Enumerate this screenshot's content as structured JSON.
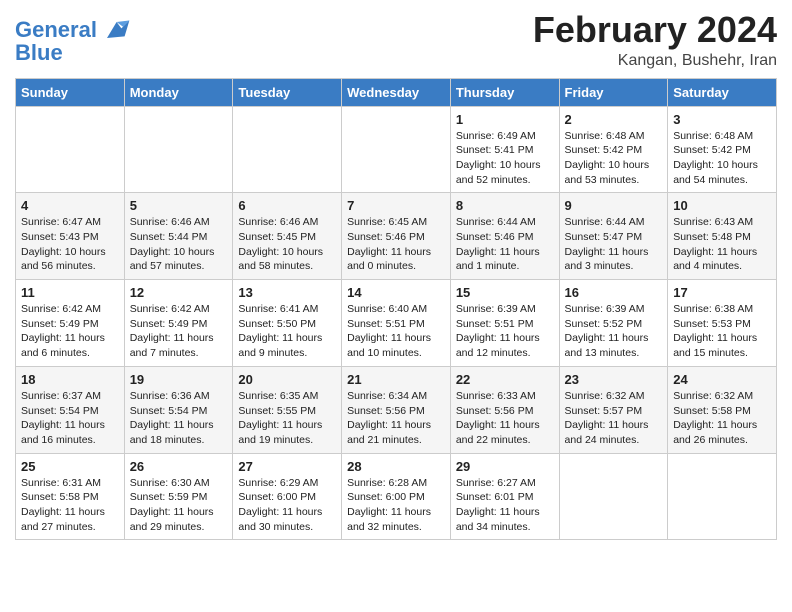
{
  "logo": {
    "line1": "General",
    "line2": "Blue"
  },
  "title": "February 2024",
  "subtitle": "Kangan, Bushehr, Iran",
  "headers": [
    "Sunday",
    "Monday",
    "Tuesday",
    "Wednesday",
    "Thursday",
    "Friday",
    "Saturday"
  ],
  "weeks": [
    [
      {
        "day": "",
        "info": ""
      },
      {
        "day": "",
        "info": ""
      },
      {
        "day": "",
        "info": ""
      },
      {
        "day": "",
        "info": ""
      },
      {
        "day": "1",
        "info": "Sunrise: 6:49 AM\nSunset: 5:41 PM\nDaylight: 10 hours\nand 52 minutes."
      },
      {
        "day": "2",
        "info": "Sunrise: 6:48 AM\nSunset: 5:42 PM\nDaylight: 10 hours\nand 53 minutes."
      },
      {
        "day": "3",
        "info": "Sunrise: 6:48 AM\nSunset: 5:42 PM\nDaylight: 10 hours\nand 54 minutes."
      }
    ],
    [
      {
        "day": "4",
        "info": "Sunrise: 6:47 AM\nSunset: 5:43 PM\nDaylight: 10 hours\nand 56 minutes."
      },
      {
        "day": "5",
        "info": "Sunrise: 6:46 AM\nSunset: 5:44 PM\nDaylight: 10 hours\nand 57 minutes."
      },
      {
        "day": "6",
        "info": "Sunrise: 6:46 AM\nSunset: 5:45 PM\nDaylight: 10 hours\nand 58 minutes."
      },
      {
        "day": "7",
        "info": "Sunrise: 6:45 AM\nSunset: 5:46 PM\nDaylight: 11 hours\nand 0 minutes."
      },
      {
        "day": "8",
        "info": "Sunrise: 6:44 AM\nSunset: 5:46 PM\nDaylight: 11 hours\nand 1 minute."
      },
      {
        "day": "9",
        "info": "Sunrise: 6:44 AM\nSunset: 5:47 PM\nDaylight: 11 hours\nand 3 minutes."
      },
      {
        "day": "10",
        "info": "Sunrise: 6:43 AM\nSunset: 5:48 PM\nDaylight: 11 hours\nand 4 minutes."
      }
    ],
    [
      {
        "day": "11",
        "info": "Sunrise: 6:42 AM\nSunset: 5:49 PM\nDaylight: 11 hours\nand 6 minutes."
      },
      {
        "day": "12",
        "info": "Sunrise: 6:42 AM\nSunset: 5:49 PM\nDaylight: 11 hours\nand 7 minutes."
      },
      {
        "day": "13",
        "info": "Sunrise: 6:41 AM\nSunset: 5:50 PM\nDaylight: 11 hours\nand 9 minutes."
      },
      {
        "day": "14",
        "info": "Sunrise: 6:40 AM\nSunset: 5:51 PM\nDaylight: 11 hours\nand 10 minutes."
      },
      {
        "day": "15",
        "info": "Sunrise: 6:39 AM\nSunset: 5:51 PM\nDaylight: 11 hours\nand 12 minutes."
      },
      {
        "day": "16",
        "info": "Sunrise: 6:39 AM\nSunset: 5:52 PM\nDaylight: 11 hours\nand 13 minutes."
      },
      {
        "day": "17",
        "info": "Sunrise: 6:38 AM\nSunset: 5:53 PM\nDaylight: 11 hours\nand 15 minutes."
      }
    ],
    [
      {
        "day": "18",
        "info": "Sunrise: 6:37 AM\nSunset: 5:54 PM\nDaylight: 11 hours\nand 16 minutes."
      },
      {
        "day": "19",
        "info": "Sunrise: 6:36 AM\nSunset: 5:54 PM\nDaylight: 11 hours\nand 18 minutes."
      },
      {
        "day": "20",
        "info": "Sunrise: 6:35 AM\nSunset: 5:55 PM\nDaylight: 11 hours\nand 19 minutes."
      },
      {
        "day": "21",
        "info": "Sunrise: 6:34 AM\nSunset: 5:56 PM\nDaylight: 11 hours\nand 21 minutes."
      },
      {
        "day": "22",
        "info": "Sunrise: 6:33 AM\nSunset: 5:56 PM\nDaylight: 11 hours\nand 22 minutes."
      },
      {
        "day": "23",
        "info": "Sunrise: 6:32 AM\nSunset: 5:57 PM\nDaylight: 11 hours\nand 24 minutes."
      },
      {
        "day": "24",
        "info": "Sunrise: 6:32 AM\nSunset: 5:58 PM\nDaylight: 11 hours\nand 26 minutes."
      }
    ],
    [
      {
        "day": "25",
        "info": "Sunrise: 6:31 AM\nSunset: 5:58 PM\nDaylight: 11 hours\nand 27 minutes."
      },
      {
        "day": "26",
        "info": "Sunrise: 6:30 AM\nSunset: 5:59 PM\nDaylight: 11 hours\nand 29 minutes."
      },
      {
        "day": "27",
        "info": "Sunrise: 6:29 AM\nSunset: 6:00 PM\nDaylight: 11 hours\nand 30 minutes."
      },
      {
        "day": "28",
        "info": "Sunrise: 6:28 AM\nSunset: 6:00 PM\nDaylight: 11 hours\nand 32 minutes."
      },
      {
        "day": "29",
        "info": "Sunrise: 6:27 AM\nSunset: 6:01 PM\nDaylight: 11 hours\nand 34 minutes."
      },
      {
        "day": "",
        "info": ""
      },
      {
        "day": "",
        "info": ""
      }
    ]
  ]
}
